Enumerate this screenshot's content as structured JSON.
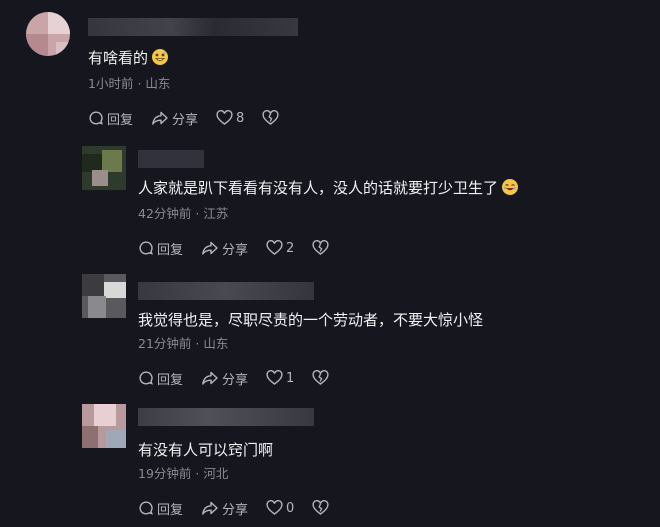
{
  "comments": [
    {
      "text": "有啥看的",
      "emoji": "grinning-sweat-emoji",
      "time": "1小时前",
      "location": "山东",
      "reply_label": "回复",
      "share_label": "分享",
      "likes": "8"
    },
    {
      "text": "人家就是趴下看看有没有人，没人的话就要打少卫生了",
      "emoji": "laughing-emoji",
      "time": "42分钟前",
      "location": "江苏",
      "reply_label": "回复",
      "share_label": "分享",
      "likes": "2"
    },
    {
      "text": "我觉得也是，尽职尽责的一个劳动者，不要大惊小怪",
      "time": "21分钟前",
      "location": "山东",
      "reply_label": "回复",
      "share_label": "分享",
      "likes": "1"
    },
    {
      "text": "有没有人可以窍门啊",
      "time": "19分钟前",
      "location": "河北",
      "reply_label": "回复",
      "share_label": "分享",
      "likes": "0"
    }
  ],
  "separator": "·"
}
